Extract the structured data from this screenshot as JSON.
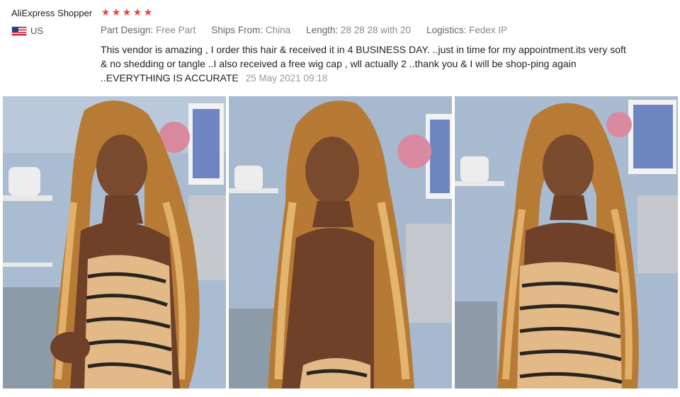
{
  "reviewer": {
    "name": "AliExpress Shopper",
    "rating": 5,
    "country": "US"
  },
  "attributes": [
    {
      "key": "Part Design:",
      "value": "Free Part"
    },
    {
      "key": "Ships From:",
      "value": "China"
    },
    {
      "key": "Length:",
      "value": "28 28 28 with 20"
    },
    {
      "key": "Logistics:",
      "value": "Fedex IP"
    }
  ],
  "review": {
    "text": "This vendor is amazing , I order this hair & received it in 4 BUSINESS DAY. ..just in time for my appointment.its very soft & no shedding or tangle ..I also received a free wig cap , wll actually 2 ..thank you & I will be shop-ping again ..EVERYTHING IS ACCURATE",
    "date": "25 May 2021 09:18"
  },
  "photos": [
    {
      "label": "review-photo-1"
    },
    {
      "label": "review-photo-2"
    },
    {
      "label": "review-photo-3"
    }
  ],
  "colors": {
    "star": "#f0403b",
    "wall": "#9db2cc",
    "hair": "#c88a3e",
    "skin": "#7a4a2e",
    "dress": "#e2b987"
  }
}
